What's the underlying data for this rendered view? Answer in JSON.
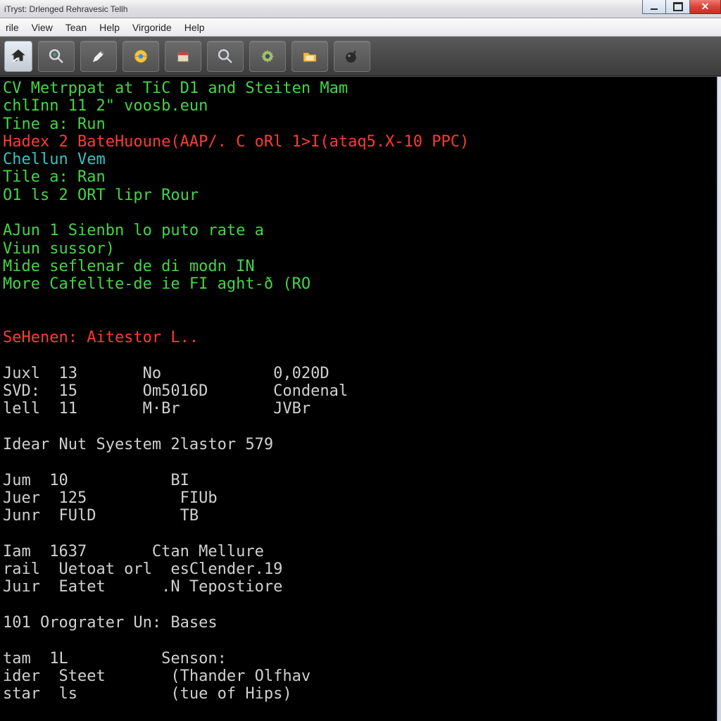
{
  "titlebar": {
    "title": "iTryst: Drlenged Rehravesic Tellh"
  },
  "menubar": {
    "items": [
      "rile",
      "View",
      "Tean",
      "Help",
      "Virgoride",
      "Help"
    ]
  },
  "toolbar": {
    "icons": [
      "home-arrow-icon",
      "magnify-dot-icon",
      "pen-icon",
      "globe-gear-icon",
      "package-icon",
      "magnify-icon",
      "gear-icon",
      "folder-icon",
      "bomb-icon"
    ]
  },
  "colors": {
    "green": "#44d544",
    "red": "#ff3b30",
    "cyan": "#3cc1c1",
    "gray": "#9c9c9c"
  },
  "terminal": {
    "lines": [
      {
        "cls": "g",
        "text": "CV Metrppat at TiC D1 and Steiten Mam"
      },
      {
        "cls": "g",
        "text": "chlInn 11 2\" voosb.eun"
      },
      {
        "cls": "g",
        "text": "Tine a: Run"
      },
      {
        "cls": "r",
        "text": "Hadex 2 BateHuoune(AAP/. C oRl 1>I(ataq5.X-10 PPC)"
      },
      {
        "cls": "c",
        "text": "Chellun Vem"
      },
      {
        "cls": "g",
        "text": "Tile a: Ran"
      },
      {
        "cls": "g",
        "text": "O1 ls 2 ORT lipr Rour"
      },
      {
        "cls": "",
        "text": ""
      },
      {
        "cls": "g",
        "text": "AJun 1 Sienbn lo puto rate a"
      },
      {
        "cls": "g",
        "text": "Viun sussor)"
      },
      {
        "cls": "g",
        "text": "Mide seflenar de di modn IN"
      },
      {
        "cls": "g",
        "text": "More Cafellte-de ie FI aght-ð (RO"
      },
      {
        "cls": "",
        "text": ""
      },
      {
        "cls": "",
        "text": ""
      },
      {
        "cls": "r",
        "text": "SeHenen: Aitestor L.."
      },
      {
        "cls": "",
        "text": ""
      },
      {
        "cls": "w",
        "text": "Juxl  13       No            0,020D"
      },
      {
        "cls": "w",
        "text": "SVD:  15       Om5016D       Condenal"
      },
      {
        "cls": "w",
        "text": "lell  11       M·Br          JVBr"
      },
      {
        "cls": "",
        "text": ""
      },
      {
        "cls": "w",
        "text": "Idear Nut Syestem 2lastor 579"
      },
      {
        "cls": "",
        "text": ""
      },
      {
        "cls": "w",
        "text": "Jum  10           BI"
      },
      {
        "cls": "w",
        "text": "Juer  125          FIUb"
      },
      {
        "cls": "w",
        "text": "Junr  FUlD         TB"
      },
      {
        "cls": "",
        "text": ""
      },
      {
        "cls": "w",
        "text": "Iam  1637       Ctan Mellure"
      },
      {
        "cls": "w",
        "text": "rail  Uetoat orl  esClender.19"
      },
      {
        "cls": "w",
        "text": "Juır  Eatet      .N Tepostiore"
      },
      {
        "cls": "",
        "text": ""
      },
      {
        "cls": "w",
        "text": "101 Orograter Un: Bases"
      },
      {
        "cls": "",
        "text": ""
      },
      {
        "cls": "w",
        "text": "tam  1L          Senson:"
      },
      {
        "cls": "w",
        "text": "ider  Steet       (Thander Olfhav"
      },
      {
        "cls": "w",
        "text": "star  ls          (tue of Hips)"
      }
    ]
  }
}
